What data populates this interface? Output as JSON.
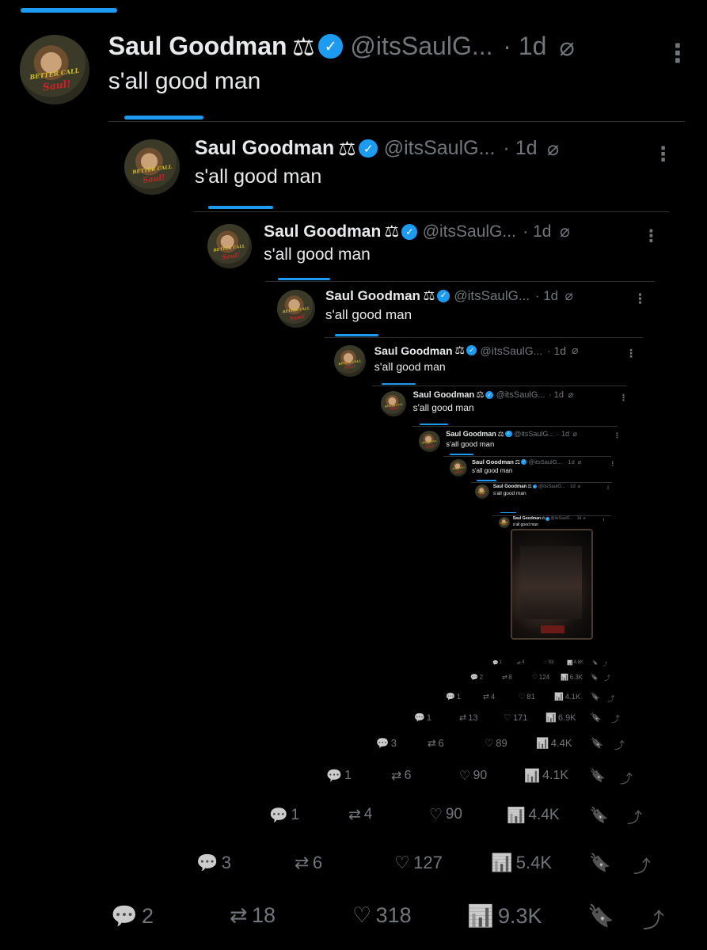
{
  "tweet": {
    "name": "Saul Goodman",
    "scales_glyph": "⚖",
    "verified_glyph": "✓",
    "handle": "@itsSaulG...",
    "time": "· 1d",
    "text": "s'all good man",
    "more_glyph": "⋮",
    "slash_glyph": "⌀",
    "avatar_logo_top": "BETTER CALL",
    "avatar_logo_bottom": "Saul!"
  },
  "icons": {
    "reply": "reply-icon",
    "retweet": "retweet-icon",
    "like": "heart-icon",
    "views": "views-icon",
    "bookmark": "bookmark-icon",
    "share": "share-icon"
  },
  "glyphs": {
    "reply": "💬",
    "retweet": "⇄",
    "like": "♡",
    "views": "📊",
    "bookmark": "🔖",
    "share": "⤴"
  },
  "stats": [
    {
      "reply": "2",
      "retweet": "18",
      "like": "318",
      "views": "9.3K"
    },
    {
      "reply": "3",
      "retweet": "6",
      "like": "127",
      "views": "5.4K"
    },
    {
      "reply": "1",
      "retweet": "4",
      "like": "90",
      "views": "4.4K"
    },
    {
      "reply": "1",
      "retweet": "6",
      "like": "90",
      "views": "4.1K"
    },
    {
      "reply": "3",
      "retweet": "6",
      "like": "89",
      "views": "4.4K"
    },
    {
      "reply": "1",
      "retweet": "13",
      "like": "171",
      "views": "6.9K"
    },
    {
      "reply": "1",
      "retweet": "4",
      "like": "81",
      "views": "4.1K"
    },
    {
      "reply": "2",
      "retweet": "8",
      "like": "124",
      "views": "6.3K"
    },
    {
      "reply": "1",
      "retweet": "4",
      "like": "93",
      "views": "4.8K"
    }
  ],
  "colors": {
    "background": "#000000",
    "accent": "#1d9bf0",
    "text": "#e7e9ea",
    "muted": "#71767b"
  }
}
